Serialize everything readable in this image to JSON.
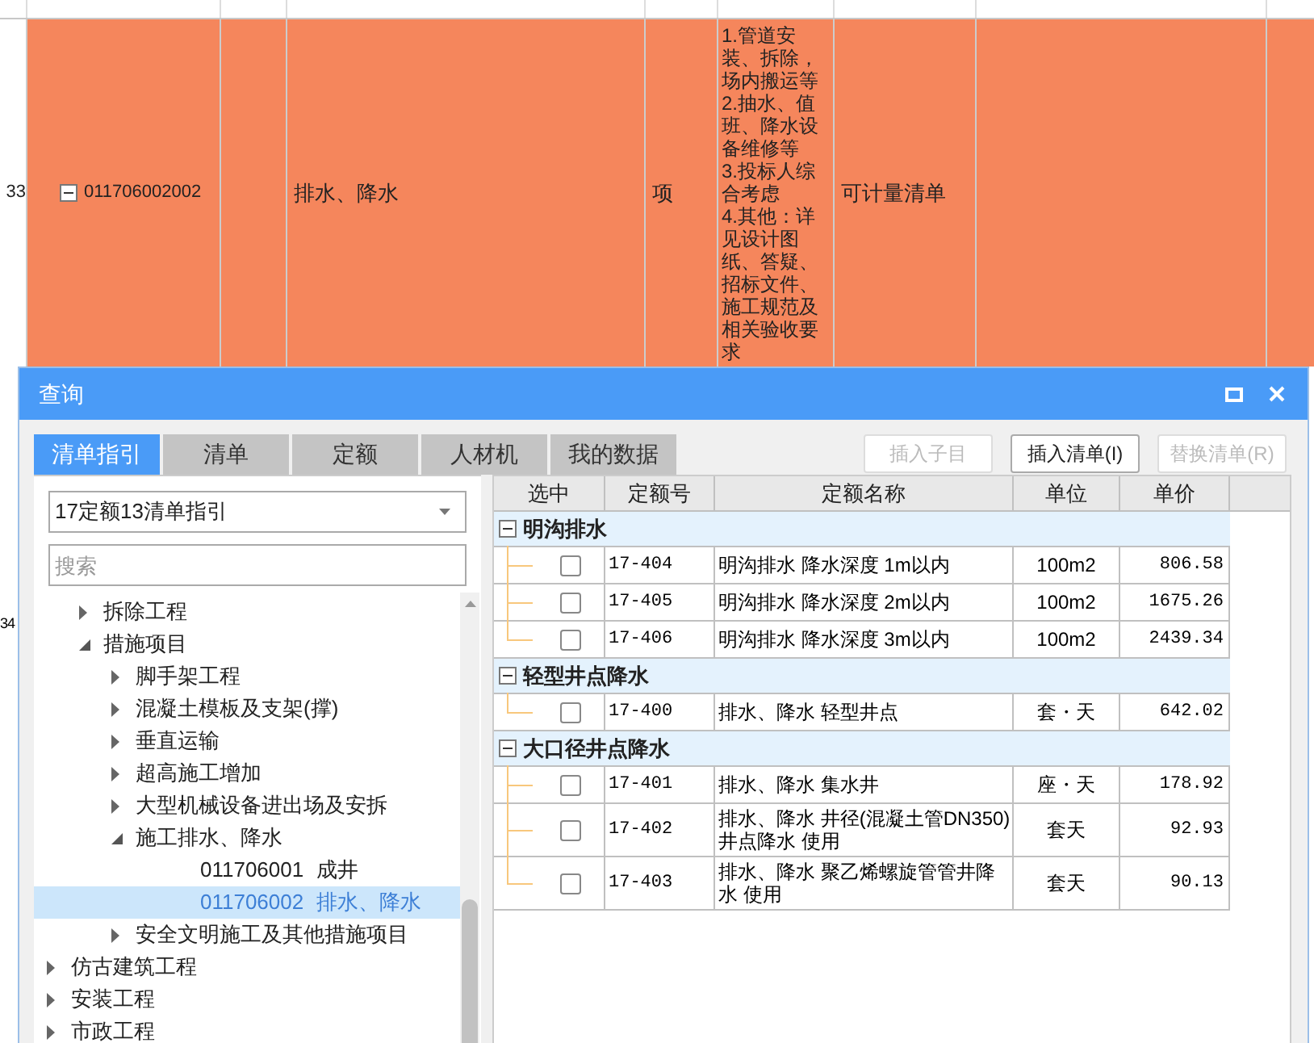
{
  "background_table": {
    "rows": [
      {
        "number": "33",
        "code": "011706002002",
        "expanded": true,
        "name": "排水、降水",
        "unit": "项",
        "description": [
          "1.管道安装、拆除，场内搬运等",
          "2.抽水、值班、降水设备维修等",
          "3.投标人综合考虑",
          "4.其他：详见设计图纸、答疑、招标文件、施工规范及相关验收要求"
        ],
        "category": "可计量清单",
        "selected": true
      }
    ],
    "next_row_number": "34"
  },
  "dialog": {
    "title": "查询",
    "tabs": [
      {
        "label": "清单指引",
        "selected": true
      },
      {
        "label": "清单",
        "selected": false
      },
      {
        "label": "定额",
        "selected": false
      },
      {
        "label": "人材机",
        "selected": false
      },
      {
        "label": "我的数据",
        "selected": false
      }
    ],
    "buttons": [
      {
        "label": "插入子目",
        "disabled": true
      },
      {
        "label": "插入清单(I)",
        "disabled": false
      },
      {
        "label": "替换清单(R)",
        "disabled": true
      }
    ],
    "guide_select": {
      "value": "17定额13清单指引"
    },
    "search": {
      "placeholder": "搜索"
    },
    "tree": [
      {
        "children": [
          {
            "label": "拆除工程",
            "expanded": false,
            "selected": false
          },
          {
            "label": "措施项目",
            "expanded": true,
            "selected": false,
            "children": [
              {
                "label": "脚手架工程",
                "expanded": false,
                "selected": false
              },
              {
                "label": "混凝土模板及支架(撑)",
                "expanded": false,
                "selected": false
              },
              {
                "label": "垂直运输",
                "expanded": false,
                "selected": false
              },
              {
                "label": "超高施工增加",
                "expanded": false,
                "selected": false
              },
              {
                "label": "大型机械设备进出场及安拆",
                "expanded": false,
                "selected": false
              },
              {
                "label": "施工排水、降水",
                "expanded": true,
                "selected": false,
                "children": [
                  {
                    "code": "011706001",
                    "label": "成井",
                    "selected": false
                  },
                  {
                    "code": "011706002",
                    "label": "排水、降水",
                    "selected": true
                  }
                ]
              },
              {
                "label": "安全文明施工及其他措施项目",
                "expanded": false,
                "selected": false
              }
            ]
          }
        ]
      },
      {
        "label": "仿古建筑工程",
        "expanded": false,
        "selected": false
      },
      {
        "label": "安装工程",
        "expanded": false,
        "selected": false
      },
      {
        "label": "市政工程",
        "expanded": false,
        "selected": false
      }
    ],
    "table": {
      "columns": [
        "选中",
        "定额号",
        "定额名称",
        "单位",
        "单价"
      ],
      "groups": [
        {
          "name": "明沟排水",
          "expanded": true,
          "items": [
            {
              "checked": false,
              "code": "17-404",
              "name": "明沟排水 降水深度 1m以内",
              "unit": "100m2",
              "price": "806.58"
            },
            {
              "checked": false,
              "code": "17-405",
              "name": "明沟排水 降水深度 2m以内",
              "unit": "100m2",
              "price": "1675.26"
            },
            {
              "checked": false,
              "code": "17-406",
              "name": "明沟排水 降水深度 3m以内",
              "unit": "100m2",
              "price": "2439.34"
            }
          ]
        },
        {
          "name": "轻型井点降水",
          "expanded": true,
          "items": [
            {
              "checked": false,
              "code": "17-400",
              "name": "排水、降水 轻型井点",
              "unit": "套・天",
              "price": "642.02"
            }
          ]
        },
        {
          "name": "大口径井点降水",
          "expanded": true,
          "items": [
            {
              "checked": false,
              "code": "17-401",
              "name": "排水、降水 集水井",
              "unit": "座・天",
              "price": "178.92"
            },
            {
              "checked": false,
              "code": "17-402",
              "name": "排水、降水 井径(混凝土管DN350)井点降水 使用",
              "unit": "套天",
              "price": "92.93"
            },
            {
              "checked": false,
              "code": "17-403",
              "name": "排水、降水 聚乙烯螺旋管管井降水 使用",
              "unit": "套天",
              "price": "90.13"
            }
          ]
        }
      ]
    }
  }
}
